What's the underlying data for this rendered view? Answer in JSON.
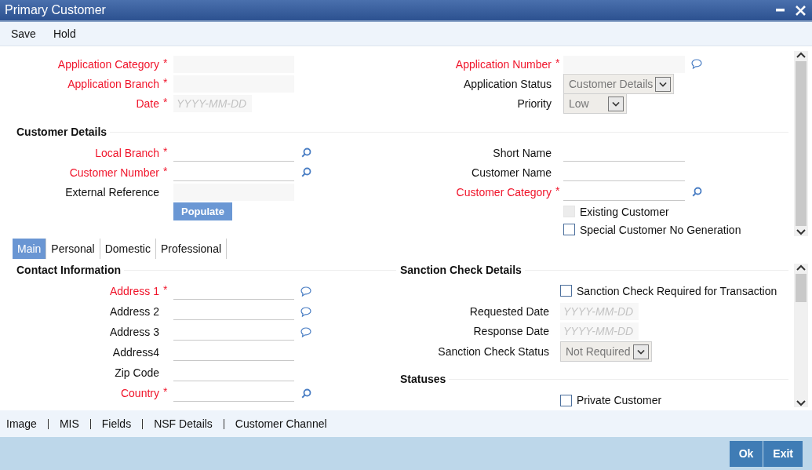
{
  "window": {
    "title": "Primary Customer"
  },
  "menu": [
    "Save",
    "Hold"
  ],
  "header": {
    "left": [
      {
        "label": "Application Category",
        "required": true,
        "mark": "*",
        "kind": "text"
      },
      {
        "label": "Application Branch",
        "required": true,
        "mark": "*",
        "kind": "text"
      },
      {
        "label": "Date",
        "required": true,
        "mark": "*",
        "kind": "date",
        "placeholder": "YYYY-MM-DD"
      }
    ],
    "right": [
      {
        "label": "Application Number",
        "required": true,
        "mark": "*",
        "kind": "text",
        "note": true
      },
      {
        "label": "Application Status",
        "required": false,
        "kind": "select",
        "value": "Customer Details"
      },
      {
        "label": "Priority",
        "required": false,
        "kind": "select",
        "value": "Low"
      }
    ]
  },
  "customer_details": {
    "title": "Customer Details",
    "left": [
      {
        "label": "Local Branch",
        "required": true,
        "mark": "*",
        "kind": "line",
        "lookup": true
      },
      {
        "label": "Customer Number",
        "required": true,
        "mark": "*",
        "kind": "line",
        "lookup": true
      },
      {
        "label": "External Reference",
        "required": false,
        "kind": "text"
      },
      {
        "kind": "button",
        "label": "Populate"
      }
    ],
    "right": [
      {
        "label": "Short Name",
        "required": false,
        "kind": "line"
      },
      {
        "label": "Customer Name",
        "required": false,
        "kind": "line"
      },
      {
        "label": "Customer Category",
        "required": true,
        "mark": "*",
        "kind": "line",
        "lookup": true
      },
      {
        "kind": "checkbox",
        "label": "Existing Customer",
        "checked": false,
        "disabled": true
      },
      {
        "kind": "checkbox",
        "label": "Special Customer No Generation",
        "checked": false,
        "disabled": false
      }
    ]
  },
  "tabs": [
    {
      "label": "Main",
      "selected": true
    },
    {
      "label": "Personal",
      "selected": false
    },
    {
      "label": "Domestic",
      "selected": false
    },
    {
      "label": "Professional",
      "selected": false
    }
  ],
  "contact_information": {
    "title": "Contact Information",
    "fields": [
      {
        "label": "Address 1",
        "required": true,
        "mark": "*",
        "kind": "line",
        "note": true
      },
      {
        "label": "Address 2",
        "required": false,
        "kind": "line",
        "note": true
      },
      {
        "label": "Address 3",
        "required": false,
        "kind": "line",
        "note": true
      },
      {
        "label": "Address4",
        "required": false,
        "kind": "line"
      },
      {
        "label": "Zip Code",
        "required": false,
        "kind": "line"
      },
      {
        "label": "Country",
        "required": true,
        "mark": "*",
        "kind": "line",
        "lookup": true
      }
    ]
  },
  "sanction_check_details": {
    "title": "Sanction Check Details",
    "fields": [
      {
        "kind": "checkbox",
        "label": "Sanction Check Required for Transaction",
        "checked": false,
        "disabled": false
      },
      {
        "label": "Requested Date",
        "required": false,
        "kind": "date",
        "placeholder": "YYYY-MM-DD"
      },
      {
        "label": "Response Date",
        "required": false,
        "kind": "date",
        "placeholder": "YYYY-MM-DD"
      },
      {
        "label": "Sanction Check Status",
        "required": false,
        "kind": "select",
        "value": "Not Required"
      }
    ]
  },
  "statuses": {
    "title": "Statuses",
    "fields": [
      {
        "kind": "checkbox",
        "label": "Private Customer",
        "checked": false,
        "disabled": false
      }
    ]
  },
  "links": [
    "Image",
    "MIS",
    "Fields",
    "NSF Details",
    "Customer Channel"
  ],
  "buttons": [
    "Ok",
    "Exit"
  ]
}
